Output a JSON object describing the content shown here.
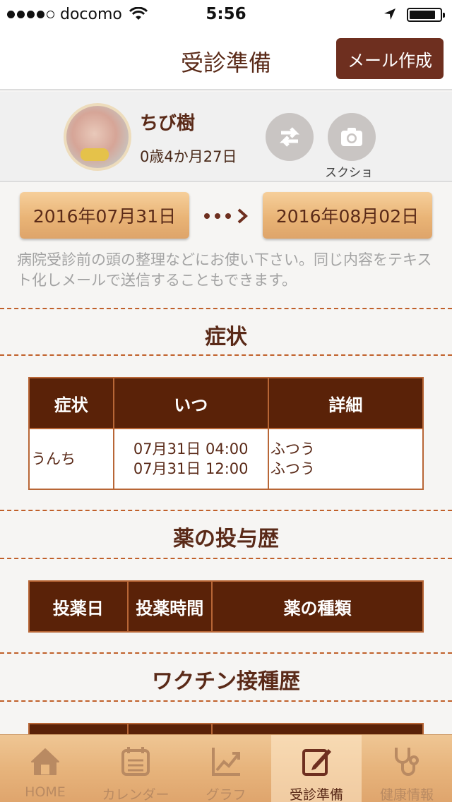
{
  "status_bar": {
    "carrier": "docomo",
    "time": "5:56",
    "signal_filled": 4,
    "signal_total": 5,
    "battery_level": 0.85
  },
  "nav": {
    "title": "受診準備",
    "mail_button": "メール作成"
  },
  "profile": {
    "name": "ちび樹",
    "age": "0歳4か月27日",
    "camera_label": "スクショ"
  },
  "date_range": {
    "from": "2016年07月31日",
    "to": "2016年08月02日"
  },
  "description": "病院受診前の頭の整理などにお使い下さい。同じ内容をテキスト化しメールで送信することもできます。",
  "sections": {
    "symptoms": {
      "title": "症状",
      "headers": [
        "症状",
        "いつ",
        "詳細"
      ],
      "rows": [
        {
          "symptom": "うんち",
          "when": [
            "07月31日 04:00",
            "07月31日 12:00"
          ],
          "detail": [
            "ふつう",
            "ふつう"
          ]
        }
      ]
    },
    "medication": {
      "title": "薬の投与歴",
      "headers": [
        "投薬日",
        "投薬時間",
        "薬の種類"
      ]
    },
    "vaccine": {
      "title": "ワクチン接種歴"
    }
  },
  "tabs": [
    {
      "label": "HOME",
      "icon": "home-icon"
    },
    {
      "label": "カレンダー",
      "icon": "calendar-icon"
    },
    {
      "label": "グラフ",
      "icon": "graph-icon"
    },
    {
      "label": "受診準備",
      "icon": "edit-icon"
    },
    {
      "label": "健康情報",
      "icon": "stethoscope-icon"
    }
  ],
  "active_tab": 3,
  "colors": {
    "accent": "#6e2f1f",
    "table_header": "#5a2208",
    "dash": "#c0602a",
    "tab_bar": "#e7b47c"
  }
}
